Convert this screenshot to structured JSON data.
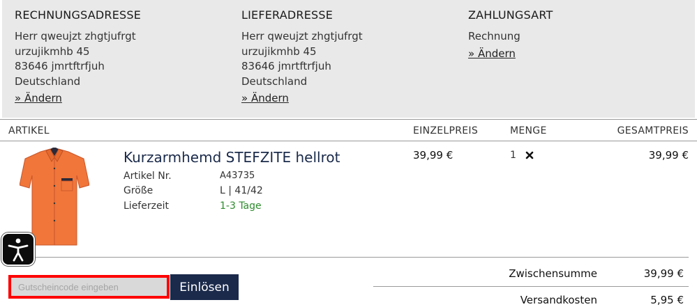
{
  "billing": {
    "heading": "RECHNUNGSADRESSE",
    "lines": [
      "Herr qweujzt zhgtjufrgt",
      "urzujikmhb 45",
      "83646 jmrtftrfjuh",
      "Deutschland"
    ],
    "change_label": "» Ändern"
  },
  "shipping": {
    "heading": "LIEFERADRESSE",
    "lines": [
      "Herr qweujzt zhgtjufrgt",
      "urzujikmhb 45",
      "83646 jmrtftrfjuh",
      "Deutschland"
    ],
    "change_label": "» Ändern"
  },
  "payment": {
    "heading": "ZAHLUNGSART",
    "method": "Rechnung",
    "change_label": "» Ändern"
  },
  "cart": {
    "columns": {
      "artikel": "ARTIKEL",
      "einzelpreis": "EINZELPREIS",
      "menge": "MENGE",
      "gesamtpreis": "GESAMTPREIS"
    },
    "item": {
      "title": "Kurzarmhemd STEFZITE hellrot",
      "article_label": "Artikel Nr.",
      "article_value": "A43735",
      "size_label": "Größe",
      "size_value": "L | 41/42",
      "delivery_label": "Lieferzeit",
      "delivery_value": "1-3 Tage",
      "unit_price": "39,99 €",
      "quantity": "1",
      "total_price": "39,99 €",
      "image_icon": "shirt-image",
      "remove_icon": "close-icon"
    }
  },
  "coupon": {
    "placeholder": "Gutscheincode eingeben",
    "button_label": "Einlösen"
  },
  "summary": {
    "subtotal_label": "Zwischensumme",
    "subtotal_value": "39,99 €",
    "shipping_label": "Versandkosten",
    "shipping_value": "5,95 €"
  },
  "accessibility": {
    "icon": "accessibility-icon"
  },
  "colors": {
    "panel_bg": "#e9e9e9",
    "primary_button": "#1b2a4b",
    "highlight_border": "#ff0000",
    "delivery_green": "#2e8b2e",
    "shirt_orange": "#f0763a"
  }
}
